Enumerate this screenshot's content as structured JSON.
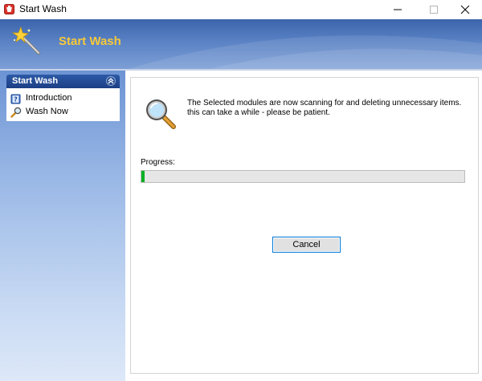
{
  "window": {
    "title": "Start Wash",
    "controls": [
      "minimize",
      "maximize",
      "close"
    ]
  },
  "banner": {
    "title": "Start Wash",
    "icon": "magic-wand-icon",
    "title_color": "#f6c93a"
  },
  "sidebar": {
    "panel_title": "Start Wash",
    "items": [
      {
        "label": "Introduction",
        "icon": "help-book-icon"
      },
      {
        "label": "Wash Now",
        "icon": "search-icon"
      }
    ]
  },
  "main": {
    "icon": "magnifier-icon",
    "message_line1": "The Selected modules are now scanning for and deleting unnecessary items.",
    "message_line2": "this can take a while - please be patient.",
    "progress_label": "Progress:",
    "progress_value": 0.01,
    "progress_color": "#06b025",
    "cancel_label": "Cancel"
  }
}
